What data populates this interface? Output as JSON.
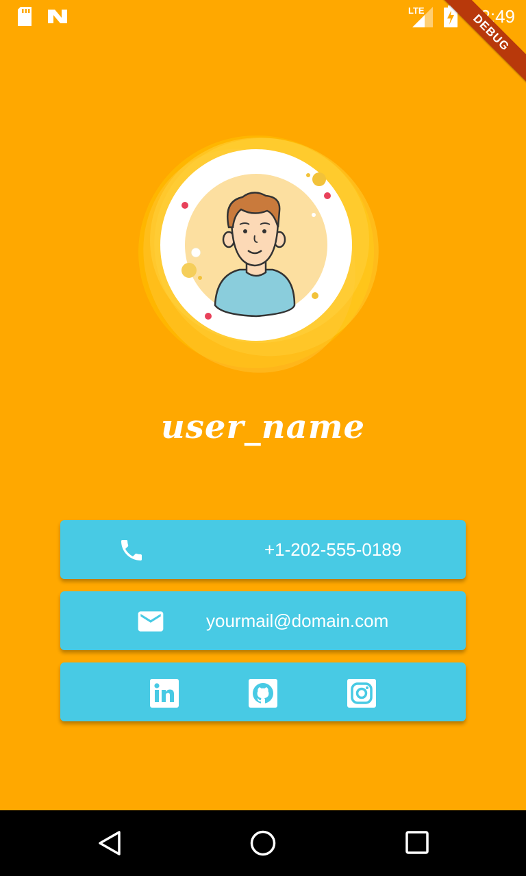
{
  "status_bar": {
    "time": "12:49",
    "network": "LTE",
    "icons": [
      "sd-card-icon",
      "n-logo-icon",
      "signal-icon",
      "battery-charging-icon"
    ]
  },
  "debug_banner": "DEBUG",
  "profile": {
    "avatar": "avatar-illustration",
    "username": "user_name"
  },
  "contact": {
    "phone": {
      "icon": "phone-icon",
      "value": "+1-202-555-0189"
    },
    "email": {
      "icon": "email-icon",
      "value": "yourmail@domain.com"
    }
  },
  "social": [
    {
      "name": "linkedin",
      "icon": "linkedin-icon"
    },
    {
      "name": "github",
      "icon": "github-icon"
    },
    {
      "name": "instagram",
      "icon": "instagram-icon"
    }
  ],
  "nav_bar": {
    "buttons": [
      "back-icon",
      "home-icon",
      "recents-icon"
    ]
  },
  "colors": {
    "background": "#FFA800",
    "card": "#48CAE4",
    "text": "#FFFFFF",
    "nav_bar": "#000000"
  }
}
